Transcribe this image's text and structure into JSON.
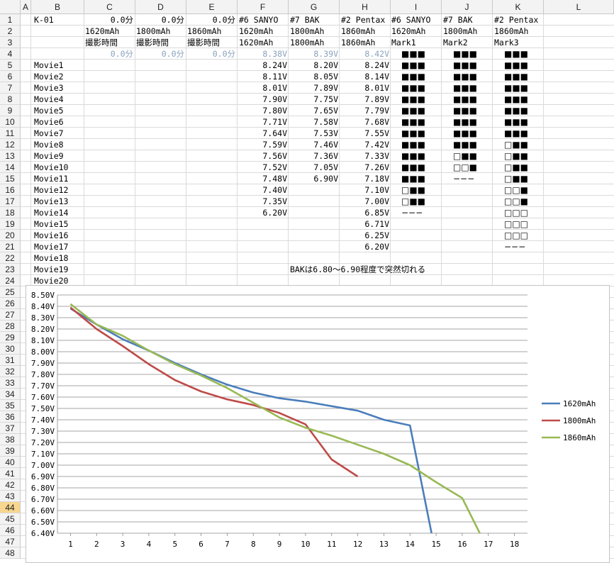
{
  "columns": [
    "A",
    "B",
    "C",
    "D",
    "E",
    "F",
    "G",
    "H",
    "I",
    "J",
    "K",
    "L"
  ],
  "rows": [
    "1",
    "2",
    "3",
    "4",
    "5",
    "6",
    "7",
    "8",
    "9",
    "10",
    "11",
    "12",
    "13",
    "14",
    "15",
    "16",
    "17",
    "18",
    "19",
    "20",
    "21",
    "22",
    "23",
    "24",
    "25",
    "26",
    "27",
    "28",
    "29",
    "30",
    "31",
    "32",
    "33",
    "34",
    "35",
    "36",
    "37",
    "38",
    "39",
    "40",
    "41",
    "42",
    "43",
    "44",
    "45",
    "46",
    "47",
    "48"
  ],
  "selected_row": "44",
  "row1": {
    "b": "K-01",
    "c": "0.0分",
    "d": "0.0分",
    "e": "0.0分",
    "f": "#6 SANYO",
    "g": "#7 BAK",
    "h": "#2 Pentax",
    "i": "#6 SANYO",
    "j": "#7 BAK",
    "k": "#2 Pentax"
  },
  "row2": {
    "c": "1620mAh",
    "d": "1800mAh",
    "e": "1860mAh",
    "f": "1620mAh",
    "g": "1800mAh",
    "h": "1860mAh",
    "i": "1620mAh",
    "j": "1800mAh",
    "k": "1860mAh"
  },
  "row3": {
    "c": "撮影時間",
    "d": "撮影時間",
    "e": "撮影時間",
    "f": "1620mAh",
    "g": "1800mAh",
    "h": "1860mAh",
    "i": "Mark1",
    "j": "Mark2",
    "k": "Mark3"
  },
  "row4": {
    "c": "0.0分",
    "d": "0.0分",
    "e": "0.0分",
    "f": "8.38V",
    "g": "8.39V",
    "h": "8.42V",
    "i": "■■■",
    "j": "■■■",
    "k": "■■■"
  },
  "movies": [
    {
      "name": "Movie1",
      "f": "8.24V",
      "g": "8.20V",
      "h": "8.24V",
      "i": "■■■",
      "j": "■■■",
      "k": "■■■"
    },
    {
      "name": "Movie2",
      "f": "8.11V",
      "g": "8.05V",
      "h": "8.14V",
      "i": "■■■",
      "j": "■■■",
      "k": "■■■"
    },
    {
      "name": "Movie3",
      "f": "8.01V",
      "g": "7.89V",
      "h": "8.01V",
      "i": "■■■",
      "j": "■■■",
      "k": "■■■"
    },
    {
      "name": "Movie4",
      "f": "7.90V",
      "g": "7.75V",
      "h": "7.89V",
      "i": "■■■",
      "j": "■■■",
      "k": "■■■"
    },
    {
      "name": "Movie5",
      "f": "7.80V",
      "g": "7.65V",
      "h": "7.79V",
      "i": "■■■",
      "j": "■■■",
      "k": "■■■"
    },
    {
      "name": "Movie6",
      "f": "7.71V",
      "g": "7.58V",
      "h": "7.68V",
      "i": "■■■",
      "j": "■■■",
      "k": "■■■"
    },
    {
      "name": "Movie7",
      "f": "7.64V",
      "g": "7.53V",
      "h": "7.55V",
      "i": "■■■",
      "j": "■■■",
      "k": "■■■"
    },
    {
      "name": "Movie8",
      "f": "7.59V",
      "g": "7.46V",
      "h": "7.42V",
      "i": "■■■",
      "j": "■■■",
      "k": "□■■"
    },
    {
      "name": "Movie9",
      "f": "7.56V",
      "g": "7.36V",
      "h": "7.33V",
      "i": "■■■",
      "j": "□■■",
      "k": "□■■"
    },
    {
      "name": "Movie10",
      "f": "7.52V",
      "g": "7.05V",
      "h": "7.26V",
      "i": "■■■",
      "j": "□□■",
      "k": "□■■"
    },
    {
      "name": "Movie11",
      "f": "7.48V",
      "g": "6.90V",
      "h": "7.18V",
      "i": "■■■",
      "j": "−−−",
      "k": "□■■"
    },
    {
      "name": "Movie12",
      "f": "7.40V",
      "g": "",
      "h": "7.10V",
      "i": "□■■",
      "j": "",
      "k": "□□■"
    },
    {
      "name": "Movie13",
      "f": "7.35V",
      "g": "",
      "h": "7.00V",
      "i": "□■■",
      "j": "",
      "k": "□□■"
    },
    {
      "name": "Movie14",
      "f": "6.20V",
      "g": "",
      "h": "6.85V",
      "i": "−−−",
      "j": "",
      "k": "□□□"
    },
    {
      "name": "Movie15",
      "f": "",
      "g": "",
      "h": "6.71V",
      "i": "",
      "j": "",
      "k": "□□□"
    },
    {
      "name": "Movie16",
      "f": "",
      "g": "",
      "h": "6.25V",
      "i": "",
      "j": "",
      "k": "□□□"
    },
    {
      "name": "Movie17",
      "f": "",
      "g": "",
      "h": "6.20V",
      "i": "",
      "j": "",
      "k": "−−−"
    },
    {
      "name": "Movie18",
      "f": "",
      "g": "",
      "h": "",
      "i": "",
      "j": "",
      "k": ""
    },
    {
      "name": "Movie19",
      "f": "",
      "g": "",
      "h": "",
      "i": "",
      "j": "",
      "k": ""
    },
    {
      "name": "Movie20",
      "f": "",
      "g": "",
      "h": "",
      "i": "",
      "j": "",
      "k": ""
    }
  ],
  "note": "BAKは6.80～6.90程度で突然切れる",
  "colors": {
    "series1": "#4a7ebb",
    "series2": "#be4b48",
    "series3": "#98b954",
    "grid": "#878787",
    "header_bg": "#f3f3f3",
    "selected_row": "#f8d68f"
  },
  "chart_data": {
    "type": "line",
    "x": [
      1,
      2,
      3,
      4,
      5,
      6,
      7,
      8,
      9,
      10,
      11,
      12,
      13,
      14,
      15,
      16,
      17,
      18
    ],
    "xticks": [
      "1",
      "2",
      "3",
      "4",
      "5",
      "6",
      "7",
      "8",
      "9",
      "10",
      "11",
      "12",
      "13",
      "14",
      "15",
      "16",
      "17",
      "18"
    ],
    "yticks": [
      "8.50V",
      "8.40V",
      "8.30V",
      "8.20V",
      "8.10V",
      "8.00V",
      "7.90V",
      "7.80V",
      "7.70V",
      "7.60V",
      "7.50V",
      "7.40V",
      "7.30V",
      "7.20V",
      "7.10V",
      "7.00V",
      "6.90V",
      "6.80V",
      "6.70V",
      "6.60V",
      "6.50V",
      "6.40V"
    ],
    "ylim": [
      6.4,
      8.5
    ],
    "grid": "horizontal",
    "legend": "right",
    "series": [
      {
        "name": "1620mAh",
        "values": [
          8.38,
          8.24,
          8.11,
          8.01,
          7.9,
          7.8,
          7.71,
          7.64,
          7.59,
          7.56,
          7.52,
          7.48,
          7.4,
          7.35,
          6.2
        ]
      },
      {
        "name": "1800mAh",
        "values": [
          8.39,
          8.2,
          8.05,
          7.89,
          7.75,
          7.65,
          7.58,
          7.53,
          7.46,
          7.36,
          7.05,
          6.9
        ]
      },
      {
        "name": "1860mAh",
        "values": [
          8.42,
          8.24,
          8.14,
          8.01,
          7.89,
          7.79,
          7.68,
          7.55,
          7.42,
          7.33,
          7.26,
          7.18,
          7.1,
          7.0,
          6.85,
          6.71,
          6.25,
          6.2
        ]
      }
    ]
  }
}
